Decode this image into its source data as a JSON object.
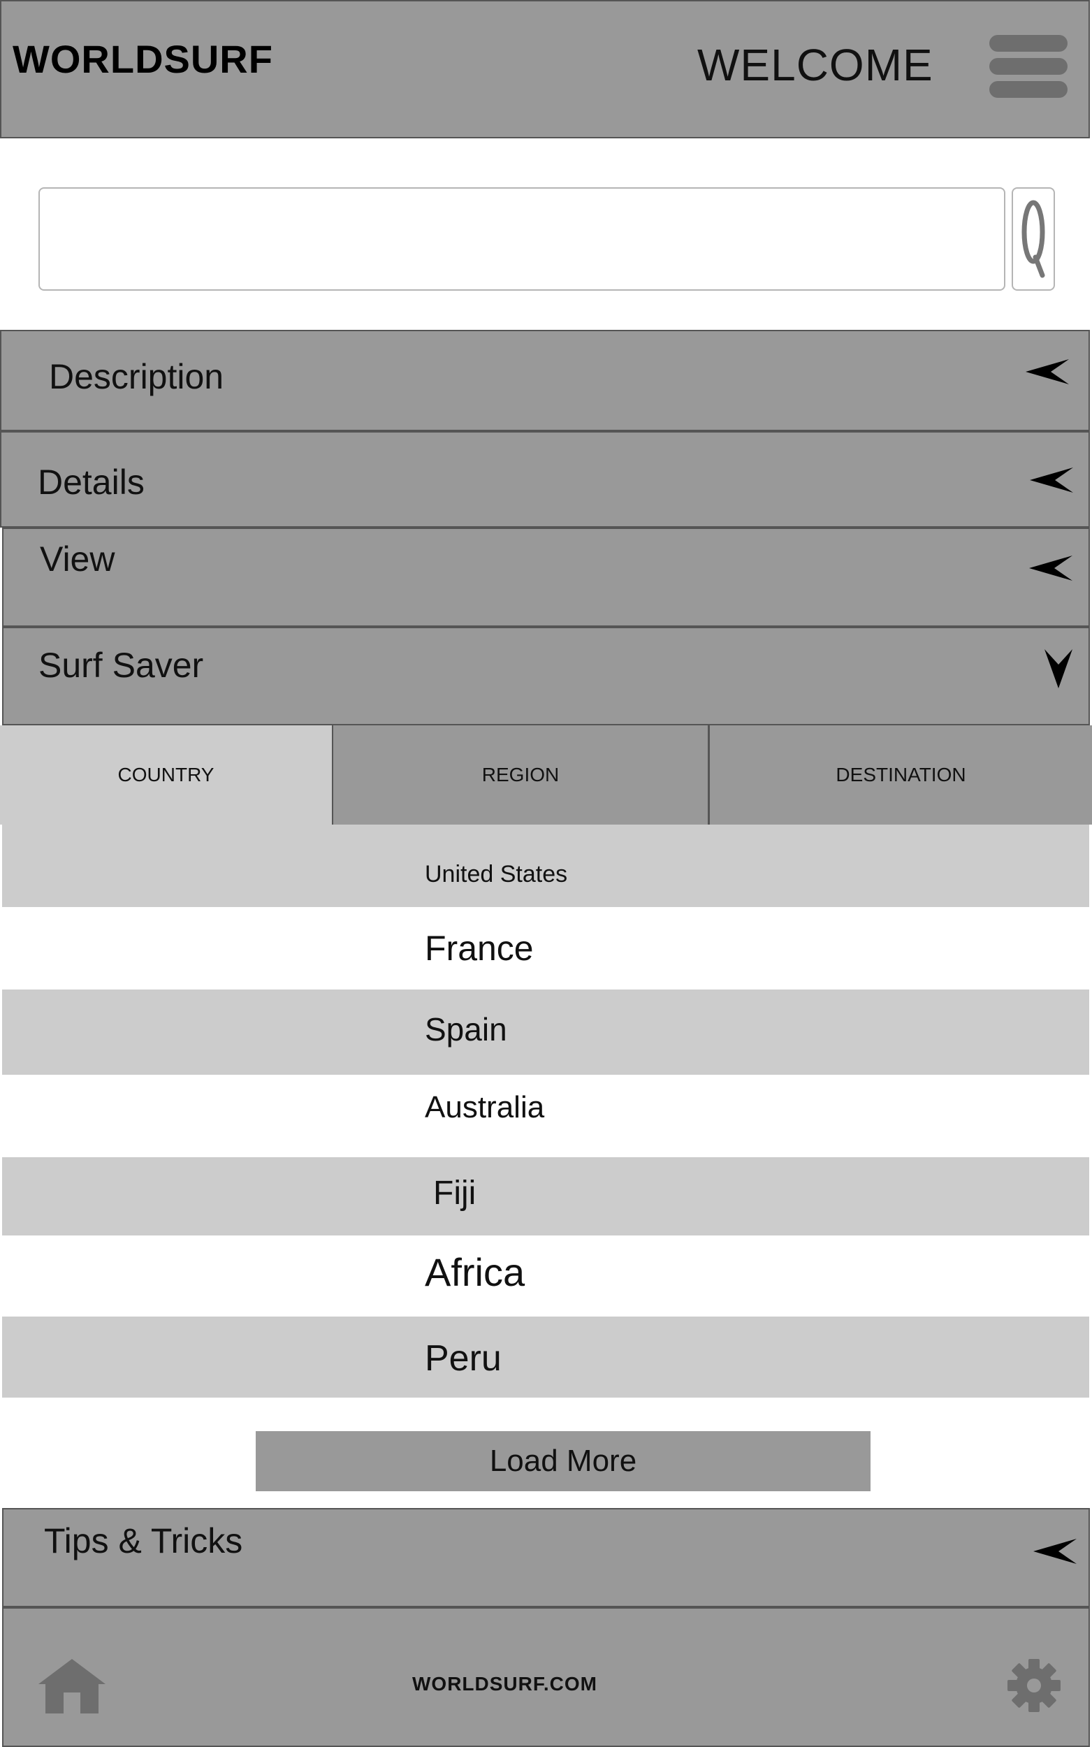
{
  "header": {
    "logo": "WORLDSURF",
    "welcome": "WELCOME",
    "menu_icon": "hamburger-menu-icon"
  },
  "search": {
    "value": "",
    "placeholder": "",
    "button_icon": "search-icon"
  },
  "accordion": {
    "description": "Description",
    "details": "Details",
    "view": "View",
    "surf_saver": "Surf Saver",
    "tips": "Tips & Tricks"
  },
  "tabs": [
    "COUNTRY",
    "REGION",
    "DESTINATION"
  ],
  "countries": [
    "United States",
    "France",
    "Spain",
    "Australia",
    "Fiji",
    "Africa",
    "Peru"
  ],
  "load_more": "Load More",
  "footer": {
    "site": "WORLDSURF.COM",
    "home_icon": "home-icon",
    "settings_icon": "gear-icon"
  },
  "colors": {
    "bar": "#999999",
    "stripe": "#cccccc",
    "active_tab": "#cccccc",
    "icon": "#6e6e6e"
  }
}
